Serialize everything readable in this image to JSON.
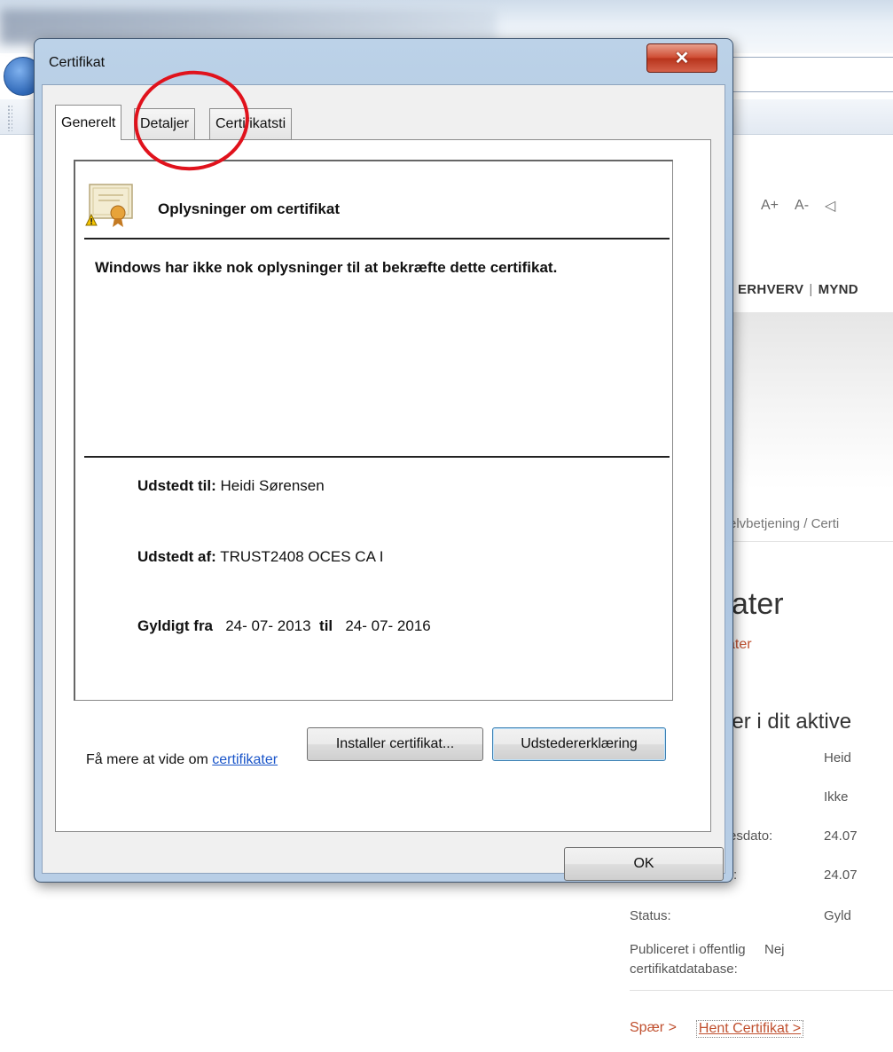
{
  "background_page": {
    "font_controls": [
      "A+",
      "A-",
      "◁"
    ],
    "nav": {
      "item1": "ERHVERV",
      "separator": "|",
      "item2": "MYND"
    },
    "breadcrumb": "elvbetjening  /  Certi",
    "page_title": "kater",
    "subtitle": "ater",
    "section_heading": "ger i dit aktive",
    "rows": [
      {
        "label": "",
        "value": "Heid"
      },
      {
        "label": "",
        "value": "Ikke"
      },
      {
        "label": "esdato:",
        "value": "24.07"
      },
      {
        "label": "):",
        "value": "24.07"
      },
      {
        "label": "Status:",
        "value": "Gyld"
      },
      {
        "label": "Publiceret i offentlig",
        "label2": "certifikatdatabase:",
        "value": "Nej"
      }
    ],
    "actions": {
      "block": "Spær  >",
      "fetch": "Hent Certifikat  >"
    }
  },
  "dialog": {
    "title": "Certifikat",
    "close_label": "✕",
    "tabs": [
      {
        "label": "Generelt",
        "active": true
      },
      {
        "label": "Detaljer",
        "active": false
      },
      {
        "label": "Certifikatsti",
        "active": false
      }
    ],
    "panel": {
      "heading": "Oplysninger om certifikat",
      "warning": "Windows har ikke nok oplysninger til at bekræfte dette certifikat.",
      "issued_to_label": "Udstedt til:",
      "issued_to_value": "Heidi Sørensen",
      "issued_by_label": "Udstedt af:",
      "issued_by_value": "TRUST2408 OCES CA I",
      "valid_from_label": "Gyldigt fra",
      "valid_from_value": "24- 07- 2013",
      "valid_to_label": "til",
      "valid_to_value": "24- 07- 2016"
    },
    "buttons": {
      "install": "Installer certifikat...",
      "issuer_statement": "Udstedererklæring",
      "ok": "OK"
    },
    "learn_more_prefix": "Få mere at vide om ",
    "learn_more_link": "certifikater"
  },
  "annotation": {
    "color": "#e0121c",
    "target": "Detaljer"
  }
}
